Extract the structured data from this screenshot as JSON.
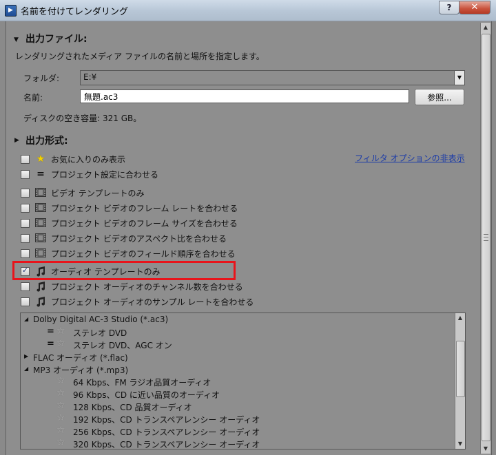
{
  "window": {
    "title": "名前を付けてレンダリング",
    "help": "?",
    "close": "✕"
  },
  "output_file": {
    "heading": "出力ファイル:",
    "description": "レンダリングされたメディア ファイルの名前と場所を指定します。",
    "folder_label": "フォルダ:",
    "folder_value": "E:¥",
    "name_label": "名前:",
    "name_value": "無題.ac3",
    "browse_label": "参照...",
    "disk_space": "ディスクの空き容量: 321 GB。"
  },
  "output_format": {
    "heading": "出力形式:",
    "filter_link": "フィルタ オプションの非表示",
    "options": [
      {
        "label": "お気に入りのみ表示",
        "icon": "star-icon",
        "checked": false
      },
      {
        "label": "プロジェクト設定に合わせる",
        "icon": "equals-icon",
        "checked": false
      },
      {
        "label": "ビデオ テンプレートのみ",
        "icon": "film-icon",
        "checked": false
      },
      {
        "label": "プロジェクト ビデオのフレーム レートを合わせる",
        "icon": "film-icon",
        "checked": false
      },
      {
        "label": "プロジェクト ビデオのフレーム サイズを合わせる",
        "icon": "film-icon",
        "checked": false
      },
      {
        "label": "プロジェクト ビデオのアスペクト比を合わせる",
        "icon": "film-icon",
        "checked": false
      },
      {
        "label": "プロジェクト ビデオのフィールド順序を合わせる",
        "icon": "film-icon",
        "checked": false
      },
      {
        "label": "オーディオ テンプレートのみ",
        "icon": "music-note-icon",
        "checked": true
      },
      {
        "label": "プロジェクト オーディオのチャンネル数を合わせる",
        "icon": "music-note-icon",
        "checked": false
      },
      {
        "label": "プロジェクト オーディオのサンプル レートを合わせる",
        "icon": "music-note-icon",
        "checked": false
      }
    ]
  },
  "format_tree": {
    "groups": [
      {
        "name": "Dolby Digital AC-3 Studio (*.ac3)",
        "expanded": true,
        "items": [
          {
            "label": "ステレオ DVD",
            "match": "="
          },
          {
            "label": "ステレオ DVD、AGC オン",
            "match": "="
          }
        ]
      },
      {
        "name": "FLAC オーディオ (*.flac)",
        "expanded": false,
        "items": []
      },
      {
        "name": "MP3 オーディオ (*.mp3)",
        "expanded": true,
        "items": [
          {
            "label": "64 Kbps、FM ラジオ品質オーディオ"
          },
          {
            "label": "96 Kbps、CD に近い品質のオーディオ"
          },
          {
            "label": "128 Kbps、CD 品質オーディオ"
          },
          {
            "label": "192 Kbps、CD トランスペアレンシー オーディオ"
          },
          {
            "label": "256 Kbps、CD トランスペアレンシー オーディオ"
          },
          {
            "label": "320 Kbps、CD トランスペアレンシー オーディオ"
          }
        ]
      }
    ]
  },
  "colors": {
    "highlight": "#e8141b",
    "link": "#1a3aa8",
    "panel": "#8e8e8e"
  }
}
